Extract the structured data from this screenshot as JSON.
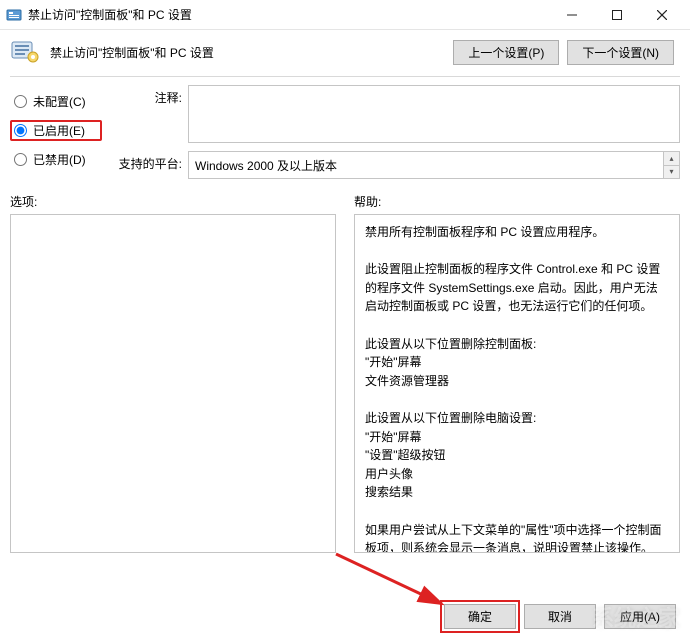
{
  "window": {
    "title": "禁止访问\"控制面板\"和 PC 设置"
  },
  "header": {
    "title": "禁止访问\"控制面板\"和 PC 设置",
    "prev": "上一个设置(P)",
    "next": "下一个设置(N)"
  },
  "radios": {
    "not_configured": "未配置(C)",
    "enabled": "已启用(E)",
    "disabled": "已禁用(D)",
    "selected": "enabled"
  },
  "fields": {
    "comment_label": "注释:",
    "comment_value": "",
    "platform_label": "支持的平台:",
    "platform_value": "Windows 2000 及以上版本"
  },
  "sections": {
    "options_label": "选项:",
    "help_label": "帮助:"
  },
  "help_text": "禁用所有控制面板程序和 PC 设置应用程序。\n\n此设置阻止控制面板的程序文件 Control.exe 和 PC 设置的程序文件 SystemSettings.exe 启动。因此，用户无法启动控制面板或 PC 设置，也无法运行它们的任何项。\n\n此设置从以下位置删除控制面板:\n\"开始\"屏幕\n文件资源管理器\n\n此设置从以下位置删除电脑设置:\n\"开始\"屏幕\n\"设置\"超级按钮\n用户头像\n搜索结果\n\n如果用户尝试从上下文菜单的\"属性\"项中选择一个控制面板项，则系统会显示一条消息，说明设置禁止该操作。",
  "footer": {
    "ok": "确定",
    "cancel": "取消",
    "apply": "应用(A)"
  },
  "watermark": "系统之家"
}
